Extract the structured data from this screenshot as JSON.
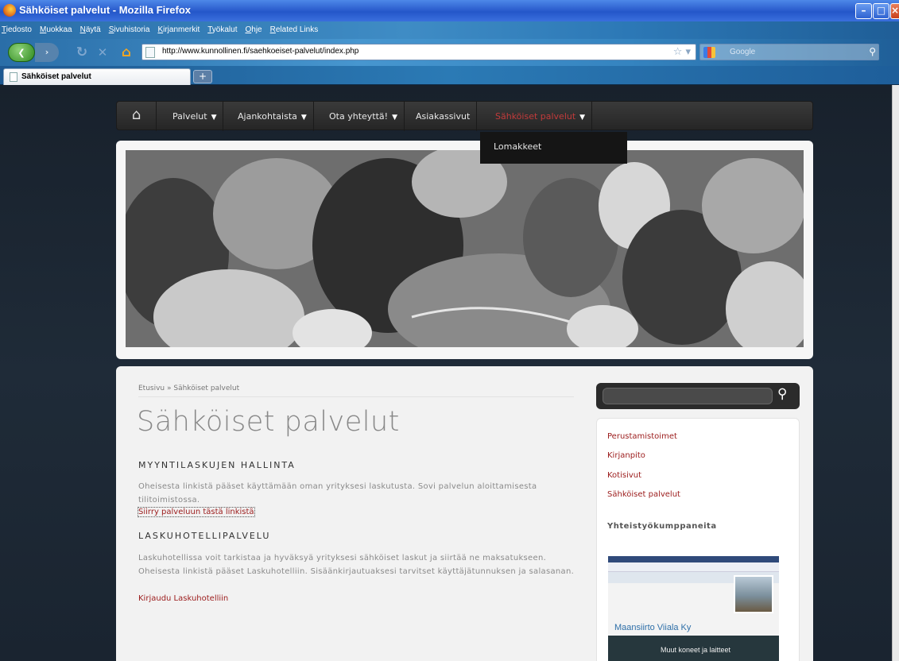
{
  "window": {
    "title": "Sähköiset palvelut - Mozilla Firefox"
  },
  "menubar": [
    "Tiedosto",
    "Muokkaa",
    "Näytä",
    "Sivuhistoria",
    "Kirjanmerkit",
    "Työkalut",
    "Ohje",
    "Related Links"
  ],
  "toolbar": {
    "url": "http://www.kunnollinen.fi/saehkoeiset-palvelut/index.php",
    "search_placeholder": "Google"
  },
  "tabs": [
    {
      "label": "Sähköiset palvelut"
    }
  ],
  "site_nav": {
    "items": [
      {
        "label": "Palvelut",
        "dropdown": true
      },
      {
        "label": "Ajankohtaista",
        "dropdown": true
      },
      {
        "label": "Ota yhteyttä!",
        "dropdown": true
      },
      {
        "label": "Asiakassivut",
        "dropdown": false
      },
      {
        "label": "Sähköiset palvelut",
        "dropdown": true,
        "active": true
      }
    ],
    "dropdown_item": "Lomakkeet"
  },
  "main": {
    "breadcrumb": "Etusivu » Sähköiset palvelut",
    "title": "Sähköiset palvelut",
    "section1": {
      "heading": "MYYNTILASKUJEN HALLINTA",
      "text": "Oheisesta linkistä pääset käyttämään oman yrityksesi laskutusta. Sovi palvelun aloittamisesta tilitoimistossa.",
      "link": "Siirry palveluun tästä linkistä"
    },
    "section2": {
      "heading": "LASKUHOTELLIPALVELU",
      "text": "Laskuhotellissa voit tarkistaa ja hyväksyä yrityksesi sähköiset laskut ja siirtää ne maksatukseen. Oheisesta linkistä pääset Laskuhotelliin. Sisäänkirjautuaksesi tarvitset käyttäjätunnuksen ja salasanan.",
      "link": "Kirjaudu Laskuhotelliin"
    }
  },
  "sidebar": {
    "links": [
      "Perustamistoimet",
      "Kirjanpito",
      "Kotisivut",
      "Sähköiset palvelut"
    ],
    "partners_heading": "Yhteistyökumppaneita",
    "partner": {
      "name": "Maansiirto Viiala Ky",
      "subtitle": "Muut koneet ja laitteet"
    }
  },
  "colors": {
    "link": "#9b1b1b",
    "nav_active": "#c23b3b",
    "nav_bg": "#262626"
  }
}
